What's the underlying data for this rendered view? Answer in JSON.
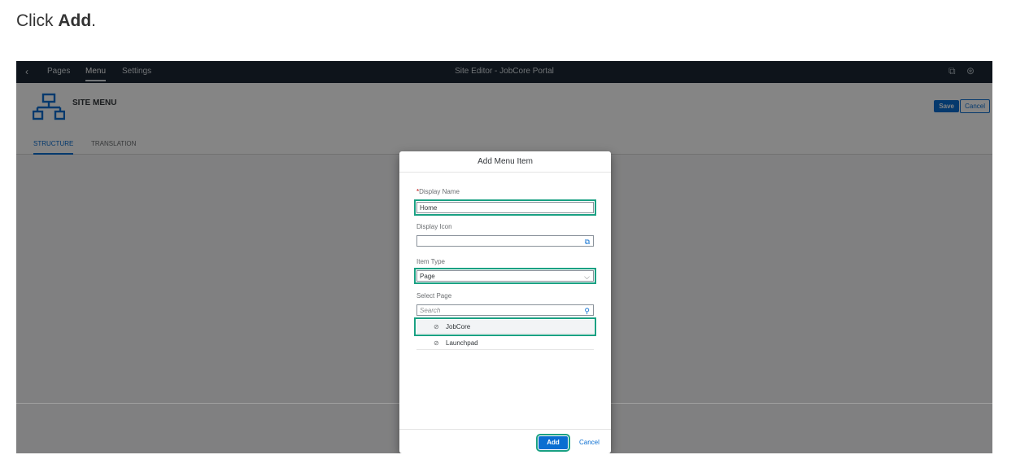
{
  "instruction": {
    "prefix": "Click ",
    "target": "Add",
    "suffix": "."
  },
  "shellbar": {
    "back_icon": "chevron-left-icon",
    "nav": [
      "Pages",
      "Menu",
      "Settings"
    ],
    "active_nav": "Menu",
    "title": "Site Editor - JobCore Portal",
    "right_icons": [
      "external-link-icon",
      "user-icon"
    ]
  },
  "header": {
    "icon": "sitemap-icon",
    "title": "SITE MENU",
    "save_label": "Save",
    "cancel_label": "Cancel",
    "tabs": [
      "STRUCTURE",
      "TRANSLATION"
    ],
    "active_tab": "STRUCTURE"
  },
  "dialog": {
    "title": "Add Menu Item",
    "display_name": {
      "required_mark": "*",
      "label": "Display Name",
      "value": "Home"
    },
    "display_icon": {
      "label": "Display Icon",
      "value": "",
      "icon": "icon-picker-icon"
    },
    "item_type": {
      "label": "Item Type",
      "value": "Page",
      "icon": "chevron-down-icon"
    },
    "select_page": {
      "label": "Select Page",
      "search_placeholder": "Search",
      "search_icon": "search-icon"
    },
    "pages": [
      {
        "name": "JobCore",
        "icon": "hidden-eye-icon",
        "selected": true
      },
      {
        "name": "Launchpad",
        "icon": "hidden-eye-icon",
        "selected": false
      }
    ],
    "add_label": "Add",
    "cancel_label": "Cancel"
  },
  "colors": {
    "shellbar": "#1c2834",
    "accent": "#0a6ed1",
    "highlight": "#1aa183",
    "required": "#bb0000"
  }
}
